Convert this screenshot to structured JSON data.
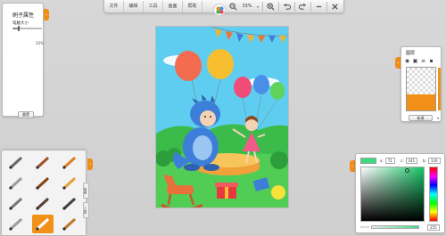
{
  "toolbar": {
    "menus": [
      "文件",
      "编辑",
      "工具",
      "画面",
      "帮助"
    ],
    "zoom": "33%",
    "zoom_caret": "▾"
  },
  "brush_panel": {
    "title": "刷子属性",
    "size_label": "笔触大小",
    "size_percent": "20%",
    "size_value": 0.2,
    "reset_label": "重置",
    "collapse_glyph": "‹"
  },
  "tools": {
    "items": [
      {
        "name": "pencil-tool-icon",
        "color": "#6b6b6b"
      },
      {
        "name": "brush-tool-icon",
        "color": "#a0522d"
      },
      {
        "name": "marker-tool-icon",
        "color": "#d9822b"
      },
      {
        "name": "eraser-tool-icon",
        "color": "#9e9e9e"
      },
      {
        "name": "fine-brush-tool-icon",
        "color": "#8b4513"
      },
      {
        "name": "crayon-tool-icon",
        "color": "#e3a33b"
      },
      {
        "name": "airbrush-tool-icon",
        "color": "#777777"
      },
      {
        "name": "flat-brush-tool-icon",
        "color": "#5d4037"
      },
      {
        "name": "pen-tool-icon",
        "color": "#444444"
      },
      {
        "name": "smudge-tool-icon",
        "color": "#9e9e9e"
      },
      {
        "name": "fill-tool-icon",
        "color": "#ffffff",
        "active": true
      },
      {
        "name": "stamp-tool-icon",
        "color": "#c17a2a"
      }
    ],
    "side_tabs": [
      "笔刷",
      "工具"
    ],
    "expand_glyph": "›"
  },
  "layers_panel": {
    "title": "图层",
    "new_label": "新建",
    "dropdown_glyph": "▾",
    "collapse_glyph": "‹"
  },
  "color_panel": {
    "current_color": "#3ddc84",
    "x_label": "x:",
    "x_value": "71",
    "c_label": "c:",
    "c_value": "241",
    "b_label": "b:",
    "b_value": "130",
    "alpha_label": "Alpha",
    "alpha_value": "255",
    "collapse_glyph": "‹"
  },
  "colors": {
    "accent": "#f08d17",
    "sky": "#5fcdf0",
    "grass": "#3bbb4a",
    "dino": "#3d7fd8"
  }
}
